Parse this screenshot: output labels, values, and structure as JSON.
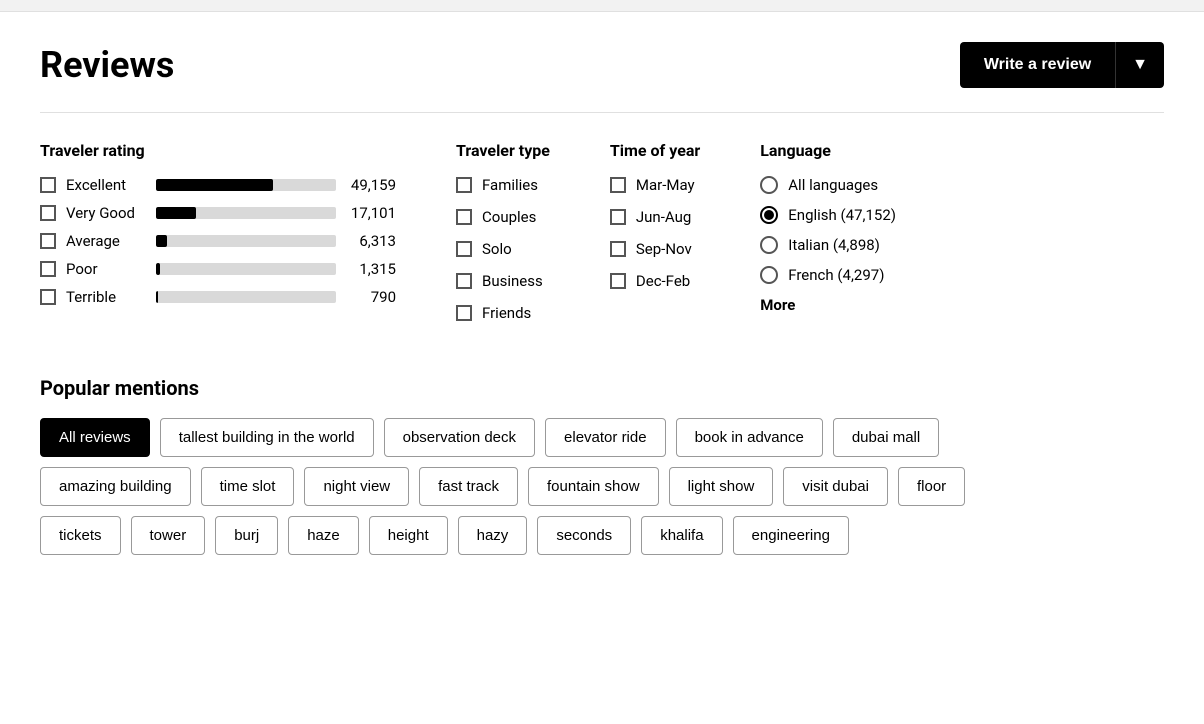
{
  "header": {
    "title": "Reviews",
    "write_review_label": "Write a review",
    "dropdown_arrow": "▼"
  },
  "traveler_rating": {
    "title": "Traveler rating",
    "items": [
      {
        "label": "Excellent",
        "count": "49,159",
        "bar_pct": 65
      },
      {
        "label": "Very Good",
        "count": "17,101",
        "bar_pct": 22
      },
      {
        "label": "Average",
        "count": "6,313",
        "bar_pct": 6
      },
      {
        "label": "Poor",
        "count": "1,315",
        "bar_pct": 2
      },
      {
        "label": "Terrible",
        "count": "790",
        "bar_pct": 1
      }
    ]
  },
  "traveler_type": {
    "title": "Traveler type",
    "items": [
      "Families",
      "Couples",
      "Solo",
      "Business",
      "Friends"
    ]
  },
  "time_of_year": {
    "title": "Time of year",
    "items": [
      "Mar-May",
      "Jun-Aug",
      "Sep-Nov",
      "Dec-Feb"
    ]
  },
  "language": {
    "title": "Language",
    "items": [
      {
        "label": "All languages",
        "selected": false
      },
      {
        "label": "English (47,152)",
        "selected": true
      },
      {
        "label": "Italian (4,898)",
        "selected": false
      },
      {
        "label": "French (4,297)",
        "selected": false
      }
    ],
    "more_label": "More"
  },
  "popular_mentions": {
    "title": "Popular mentions",
    "rows": [
      [
        {
          "label": "All reviews",
          "active": true
        },
        {
          "label": "tallest building in the world",
          "active": false
        },
        {
          "label": "observation deck",
          "active": false
        },
        {
          "label": "elevator ride",
          "active": false
        },
        {
          "label": "book in advance",
          "active": false
        },
        {
          "label": "dubai mall",
          "active": false
        }
      ],
      [
        {
          "label": "amazing building",
          "active": false
        },
        {
          "label": "time slot",
          "active": false
        },
        {
          "label": "night view",
          "active": false
        },
        {
          "label": "fast track",
          "active": false
        },
        {
          "label": "fountain show",
          "active": false
        },
        {
          "label": "light show",
          "active": false
        },
        {
          "label": "visit dubai",
          "active": false
        },
        {
          "label": "floor",
          "active": false
        }
      ],
      [
        {
          "label": "tickets",
          "active": false
        },
        {
          "label": "tower",
          "active": false
        },
        {
          "label": "burj",
          "active": false
        },
        {
          "label": "haze",
          "active": false
        },
        {
          "label": "height",
          "active": false
        },
        {
          "label": "hazy",
          "active": false
        },
        {
          "label": "seconds",
          "active": false
        },
        {
          "label": "khalifa",
          "active": false
        },
        {
          "label": "engineering",
          "active": false
        }
      ]
    ]
  }
}
